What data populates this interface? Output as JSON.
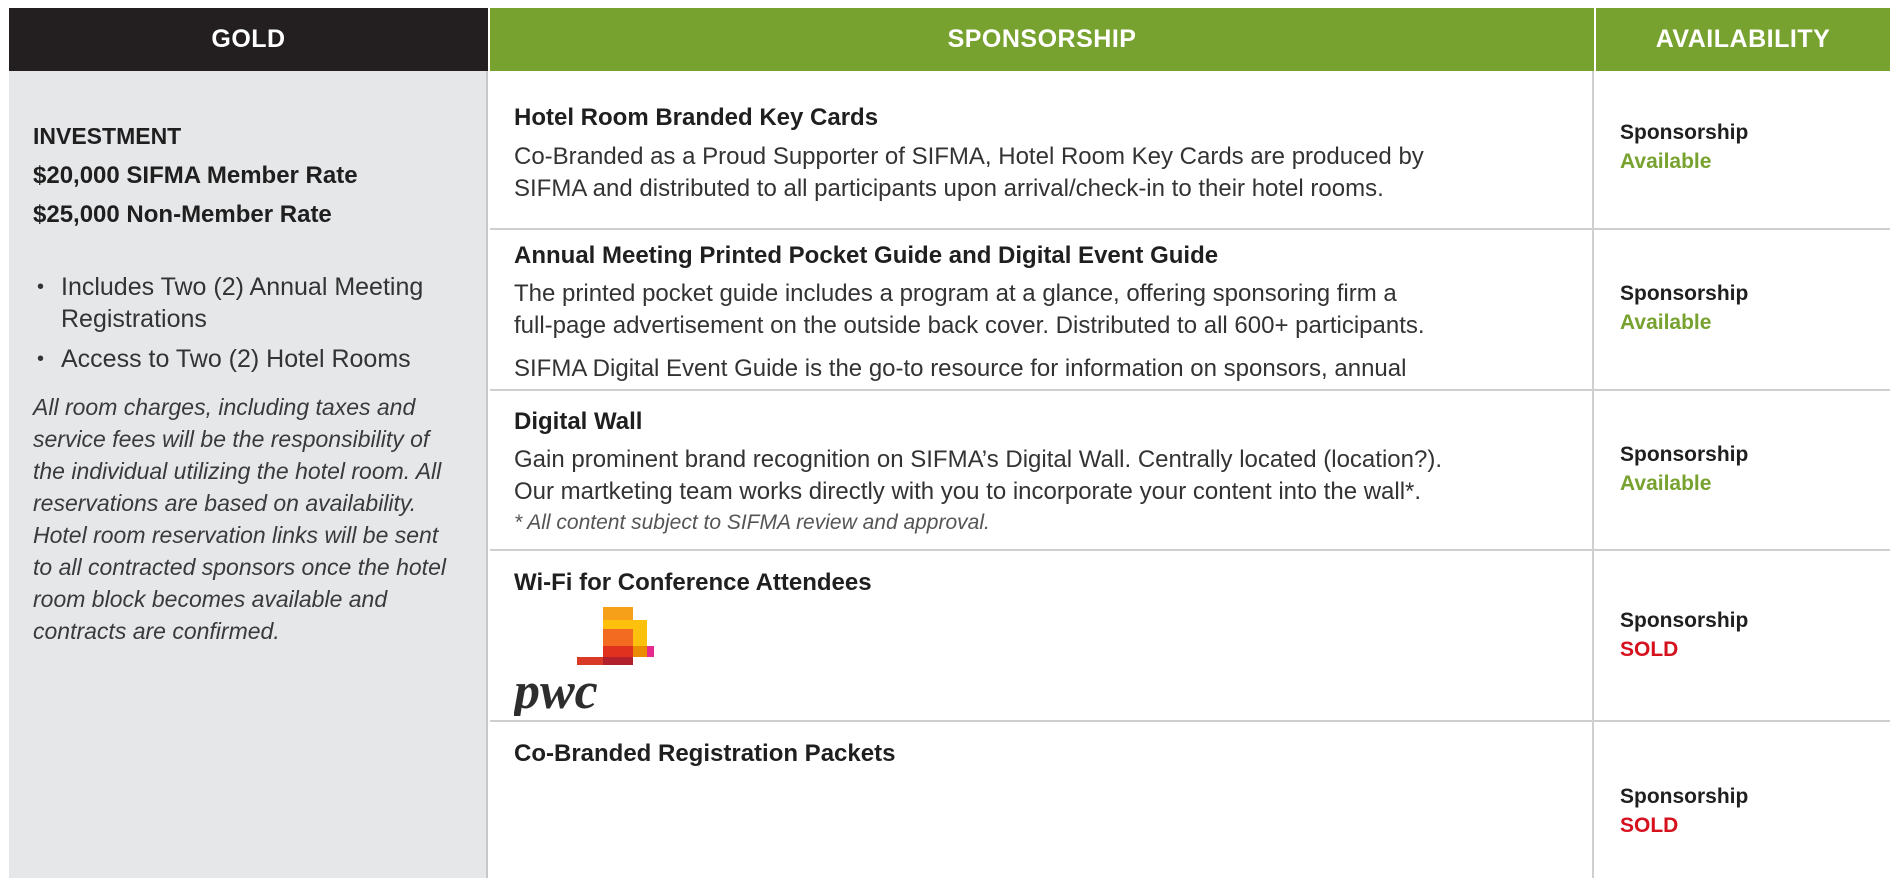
{
  "headers": {
    "gold": "GOLD",
    "sponsorship": "SPONSORSHIP",
    "availability": "AVAILABILITY"
  },
  "gold": {
    "investment_title": "INVESTMENT",
    "member_rate": "$20,000 SIFMA Member Rate",
    "nonmember_rate": "$25,000 Non-Member Rate",
    "bullets": [
      "Includes Two (2) Annual Meeting Registrations",
      "Access to Two (2) Hotel Rooms"
    ],
    "note": "All room charges, including taxes and service fees will be the responsibility of the individual utilizing the hotel room. All reservations are based on availability. Hotel room reservation links will be sent to all contracted sponsors once the hotel room block becomes available and contracts are confirmed."
  },
  "rows": [
    {
      "title": "Hotel Room Branded Key Cards",
      "desc": [
        "Co-Branded as a Proud Supporter of SIFMA, Hotel Room Key Cards are produced by",
        "SIFMA and distributed to all participants upon arrival/check-in to their hotel rooms."
      ],
      "availability_label": "Sponsorship",
      "status": "Available"
    },
    {
      "title": "Annual Meeting Printed Pocket Guide and Digital Event Guide",
      "desc": [
        "The printed pocket guide includes a program at a glance, offering sponsoring firm a",
        "full-page advertisement on the outside back cover. Distributed to all 600+ participants.",
        "SIFMA Digital Event Guide is the go-to resource for information on sponsors, annual"
      ],
      "availability_label": "Sponsorship",
      "status": "Available"
    },
    {
      "title": "Digital Wall",
      "desc": [
        "Gain prominent brand recognition on SIFMA’s Digital Wall. Centrally located (location?).",
        "Our martketing team works directly with you to incorporate your content into the wall*."
      ],
      "fine_print": "* All content subject to SIFMA review and approval.",
      "availability_label": "Sponsorship",
      "status": "Available"
    },
    {
      "title": "Wi-Fi for Conference Attendees",
      "logo_text": "pwc",
      "availability_label": "Sponsorship",
      "status": "SOLD"
    },
    {
      "title": "Co-Branded Registration Packets",
      "availability_label": "Sponsorship",
      "status": "SOLD"
    }
  ],
  "colors": {
    "green": "#78a22f",
    "black": "#231f20",
    "sold": "#d6111e",
    "gold_bg": "#e6e7e9"
  }
}
